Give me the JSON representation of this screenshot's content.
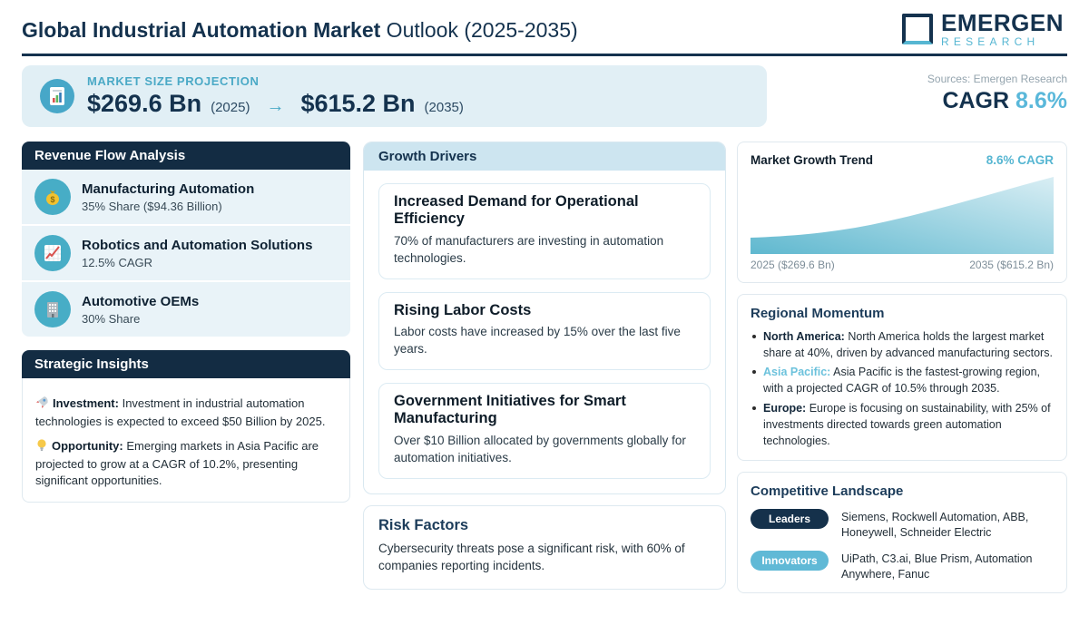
{
  "header": {
    "title_bold": "Global Industrial Automation Market",
    "title_regular": " Outlook (2025-2035)",
    "logo_line1": "EMERGEN",
    "logo_line2": "RESEARCH"
  },
  "banner": {
    "label": "MARKET SIZE PROJECTION",
    "start_value": "$269.6 Bn",
    "start_year": "(2025)",
    "arrow": "→",
    "end_value": "$615.2 Bn",
    "end_year": "(2035)",
    "sources": "Sources: Emergen Research",
    "cagr_label": "CAGR",
    "cagr_value": "8.6%"
  },
  "revenue_flow": {
    "title": "Revenue Flow Analysis",
    "items": [
      {
        "icon": "money-bag-icon",
        "title": "Manufacturing Automation",
        "subtitle": "35% Share ($94.36 Billion)"
      },
      {
        "icon": "line-chart-icon",
        "title": "Robotics and Automation Solutions",
        "subtitle": "12.5% CAGR"
      },
      {
        "icon": "building-icon",
        "title": "Automotive OEMs",
        "subtitle": "30% Share"
      }
    ]
  },
  "strategic_insights": {
    "title": "Strategic Insights",
    "items": [
      {
        "icon": "rocket-icon",
        "label": "Investment:",
        "text": " Investment in industrial automation technologies is expected to exceed $50 Billion by 2025."
      },
      {
        "icon": "bulb-icon",
        "label": "Opportunity:",
        "text": " Emerging markets in Asia Pacific are projected to grow at a CAGR of 10.2%, presenting significant opportunities."
      }
    ]
  },
  "growth_drivers": {
    "title": "Growth Drivers",
    "cards": [
      {
        "title": "Increased Demand for Operational Efficiency",
        "text": "70% of manufacturers are investing in automation technologies."
      },
      {
        "title": "Rising Labor Costs",
        "text": "Labor costs have increased by 15% over the last five years."
      },
      {
        "title": "Government Initiatives for Smart Manufacturing",
        "text": "Over $10 Billion allocated by governments globally for automation initiatives."
      }
    ]
  },
  "risk_factors": {
    "title": "Risk Factors",
    "text": "Cybersecurity threats pose a significant risk, with 60% of companies reporting incidents."
  },
  "chart_data": {
    "type": "area",
    "title": "Market Growth Trend",
    "cagr_label": "8.6% CAGR",
    "x": [
      2025,
      2035
    ],
    "values": [
      269.6,
      615.2
    ],
    "x_start_label": "2025 ($269.6 Bn)",
    "x_end_label": "2035 ($615.2 Bn)",
    "legend_position": "none",
    "grid": false
  },
  "regional_momentum": {
    "title": "Regional Momentum",
    "items": [
      {
        "label": "North America:",
        "text": " North America holds the largest market share at 40%, driven by advanced manufacturing sectors."
      },
      {
        "label": "Asia Pacific:",
        "text": " Asia Pacific is the fastest-growing region, with a projected CAGR of 10.5% through 2035."
      },
      {
        "label": "Europe:",
        "text": " Europe is focusing on sustainability, with 25% of investments directed towards green automation technologies."
      }
    ]
  },
  "competitive_landscape": {
    "title": "Competitive Landscape",
    "rows": [
      {
        "badge": "Leaders",
        "text": "Siemens, Rockwell Automation, ABB, Honeywell, Schneider Electric"
      },
      {
        "badge": "Innovators",
        "text": "UiPath, C3.ai, Blue Prism, Automation Anywhere, Fanuc"
      }
    ]
  },
  "colors": {
    "navy": "#14324e",
    "dark_panel_header": "#132c43",
    "accent_teal": "#56b6d2",
    "banner_bg": "#e1eff5",
    "item_row_bg": "#e9f3f8",
    "growth_header_bg": "#cde5f0",
    "leaders_badge": "#15314b",
    "innovators_badge": "#60b9d6",
    "chart_fill_start": "#5fb8cf",
    "chart_fill_end": "#d9eef4"
  }
}
